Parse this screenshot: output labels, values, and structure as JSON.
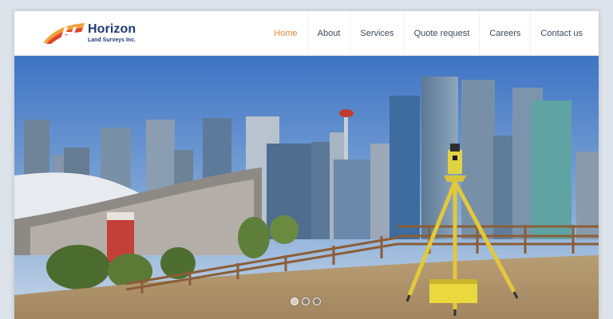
{
  "brand": {
    "name": "Horizon",
    "tagline": "Land Surveys Inc.",
    "accent_color": "#e8863a",
    "primary_color": "#1e3a78"
  },
  "nav": {
    "items": [
      {
        "label": "Home",
        "active": true
      },
      {
        "label": "About",
        "active": false
      },
      {
        "label": "Services",
        "active": false
      },
      {
        "label": "Quote request",
        "active": false
      },
      {
        "label": "Careers",
        "active": false
      },
      {
        "label": "Contact us",
        "active": false
      }
    ]
  },
  "hero": {
    "image": "city-skyline-with-surveying-tripod-icon",
    "slides_count": 3,
    "active_slide": 1
  }
}
